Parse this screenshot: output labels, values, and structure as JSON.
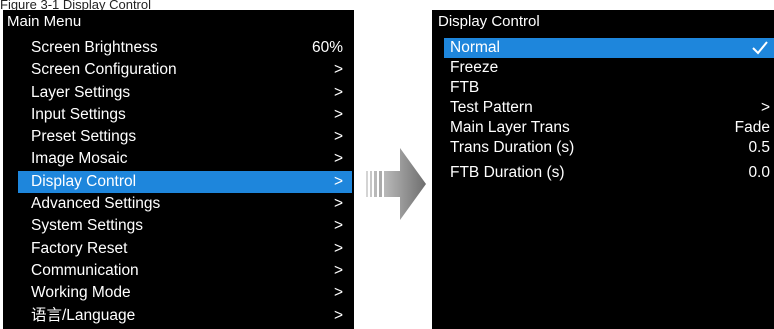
{
  "caption": "Figure 3-1 Display Control",
  "main_menu": {
    "title": "Main Menu",
    "items": [
      {
        "label": "Screen Brightness",
        "value": "60%",
        "selected": false
      },
      {
        "label": "Screen Configuration",
        "value": ">",
        "selected": false
      },
      {
        "label": "Layer Settings",
        "value": ">",
        "selected": false
      },
      {
        "label": "Input Settings",
        "value": ">",
        "selected": false
      },
      {
        "label": "Preset Settings",
        "value": ">",
        "selected": false
      },
      {
        "label": "Image Mosaic",
        "value": ">",
        "selected": false
      },
      {
        "label": "Display Control",
        "value": ">",
        "selected": true
      },
      {
        "label": "Advanced Settings",
        "value": ">",
        "selected": false
      },
      {
        "label": "System Settings",
        "value": ">",
        "selected": false
      },
      {
        "label": "Factory Reset",
        "value": ">",
        "selected": false
      },
      {
        "label": "Communication",
        "value": ">",
        "selected": false
      },
      {
        "label": "Working Mode",
        "value": ">",
        "selected": false
      },
      {
        "label": "语言/Language",
        "value": ">",
        "selected": false
      }
    ]
  },
  "display_control": {
    "title": "Display Control",
    "items": [
      {
        "label": "Normal",
        "value": "",
        "icon": "check-icon",
        "selected": true
      },
      {
        "label": "Freeze",
        "value": "",
        "selected": false
      },
      {
        "label": "FTB",
        "value": "",
        "selected": false
      },
      {
        "label": "Test Pattern",
        "value": ">",
        "selected": false
      },
      {
        "label": "Main Layer Trans",
        "value": "Fade",
        "selected": false
      },
      {
        "label": "Trans Duration (s)",
        "value": "0.5",
        "selected": false
      },
      {
        "label": "FTB Duration (s)",
        "value": "0.0",
        "selected": false
      }
    ]
  },
  "colors": {
    "panel_background": "#000000",
    "selection": "#1e86dc",
    "text": "#ffffff",
    "arrow": "#8a8a8a"
  },
  "icons": {
    "transition": "right-arrow-icon",
    "selected_marker": "check-icon"
  }
}
